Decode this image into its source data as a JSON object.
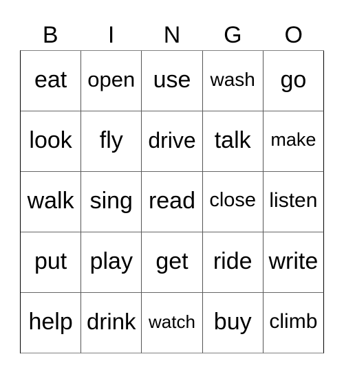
{
  "header": {
    "letters": [
      "B",
      "I",
      "N",
      "G",
      "O"
    ]
  },
  "board": {
    "rows": [
      [
        "eat",
        "open",
        "use",
        "wash",
        "go"
      ],
      [
        "look",
        "fly",
        "drive",
        "talk",
        "make"
      ],
      [
        "walk",
        "sing",
        "read",
        "close",
        "listen"
      ],
      [
        "put",
        "play",
        "get",
        "ride",
        "write"
      ],
      [
        "help",
        "drink",
        "watch",
        "buy",
        "climb"
      ]
    ]
  }
}
